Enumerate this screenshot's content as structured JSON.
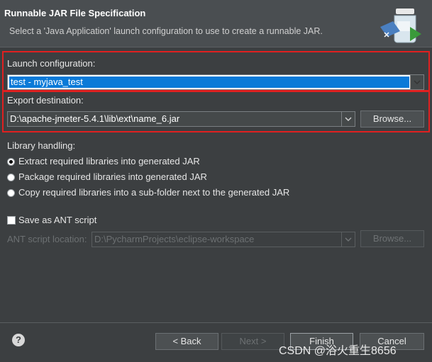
{
  "header": {
    "title": "Runnable JAR File Specification",
    "description": "Select a 'Java Application' launch configuration to use to create a runnable JAR."
  },
  "launch": {
    "label": "Launch configuration:",
    "value": "test - myjava_test"
  },
  "export": {
    "label": "Export destination:",
    "value": "D:\\apache-jmeter-5.4.1\\lib\\ext\\name_6.jar",
    "browse_label": "Browse..."
  },
  "library": {
    "label": "Library handling:",
    "options": [
      {
        "label": "Extract required libraries into generated JAR",
        "selected": true
      },
      {
        "label": "Package required libraries into generated JAR",
        "selected": false
      },
      {
        "label": "Copy required libraries into a sub-folder next to the generated JAR",
        "selected": false
      }
    ]
  },
  "ant": {
    "checkbox_label": "Save as ANT script",
    "checked": false,
    "location_label": "ANT script location:",
    "location_value": "D:\\PycharmProjects\\eclipse-workspace",
    "browse_label": "Browse..."
  },
  "buttons": {
    "back": "< Back",
    "next": "Next >",
    "finish": "Finish",
    "cancel": "Cancel"
  },
  "help_icon": "?",
  "watermark": "CSDN @浴火重生8656",
  "colors": {
    "background": "#3c3f41",
    "selection": "#0a7ad8",
    "highlight_border": "#e02020"
  },
  "icons": [
    "wizard-jar-icon",
    "help-icon",
    "chevron-down-icon"
  ]
}
